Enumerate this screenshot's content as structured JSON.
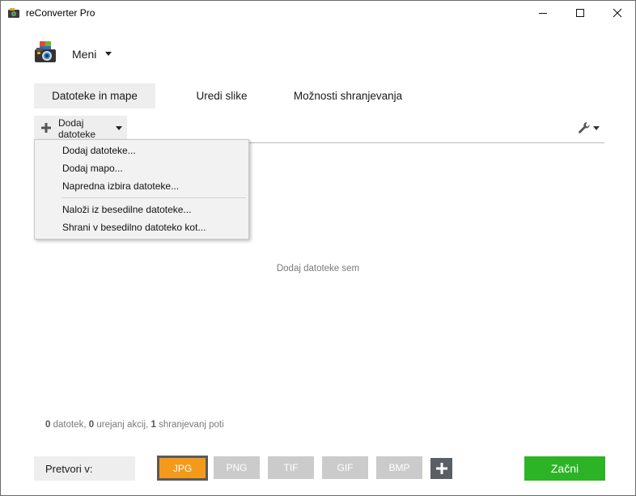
{
  "window": {
    "title": "reConverter Pro"
  },
  "menu": {
    "label": "Meni"
  },
  "tabs": [
    {
      "label": "Datoteke in mape",
      "active": true
    },
    {
      "label": "Uredi slike",
      "active": false
    },
    {
      "label": "Možnosti shranjevanja",
      "active": false
    }
  ],
  "add_button": {
    "line1": "Dodaj",
    "line2": "datoteke"
  },
  "dropdown": {
    "items": [
      "Dodaj datoteke...",
      "Dodaj mapo...",
      "Napredna izbira datoteke...",
      "Naloži iz besedilne datoteke...",
      "Shrani v besedilno datoteko kot..."
    ]
  },
  "drop_hint": "Dodaj datoteke sem",
  "status": {
    "files_count": "0",
    "files_label": "datotek,",
    "actions_count": "0",
    "actions_label": "urejanj akcij,",
    "paths_count": "1",
    "paths_label": "shranjevanj poti"
  },
  "convert": {
    "label": "Pretvori v:",
    "formats": [
      "JPG",
      "PNG",
      "TIF",
      "GIF",
      "BMP"
    ],
    "selected": "JPG"
  },
  "start_button": "Začni",
  "colors": {
    "accent": "#f39a1a",
    "start": "#2cb426",
    "tab_bg": "#eeeeee"
  }
}
